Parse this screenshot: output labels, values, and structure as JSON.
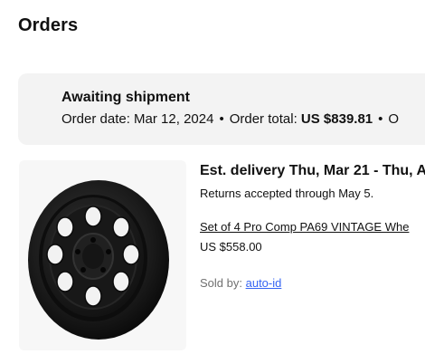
{
  "page": {
    "title": "Orders"
  },
  "order": {
    "status": "Awaiting shipment",
    "date_label": "Order date:",
    "date_value": "Mar 12, 2024",
    "separator": "•",
    "total_label": "Order total:",
    "total_value": "US $839.81",
    "next_label_fragment": "O"
  },
  "item": {
    "image_icon": "wheel-image",
    "delivery": "Est. delivery Thu, Mar 21 - Thu, A",
    "returns": "Returns accepted through May 5.",
    "title": "Set of 4 Pro Comp PA69 VINTAGE Whe",
    "price": "US $558.00",
    "sold_by_label": "Sold by:",
    "seller": "auto-id"
  },
  "colors": {
    "link": "#3665f3",
    "card_background": "#f3f3f3",
    "muted_text": "#707070"
  }
}
